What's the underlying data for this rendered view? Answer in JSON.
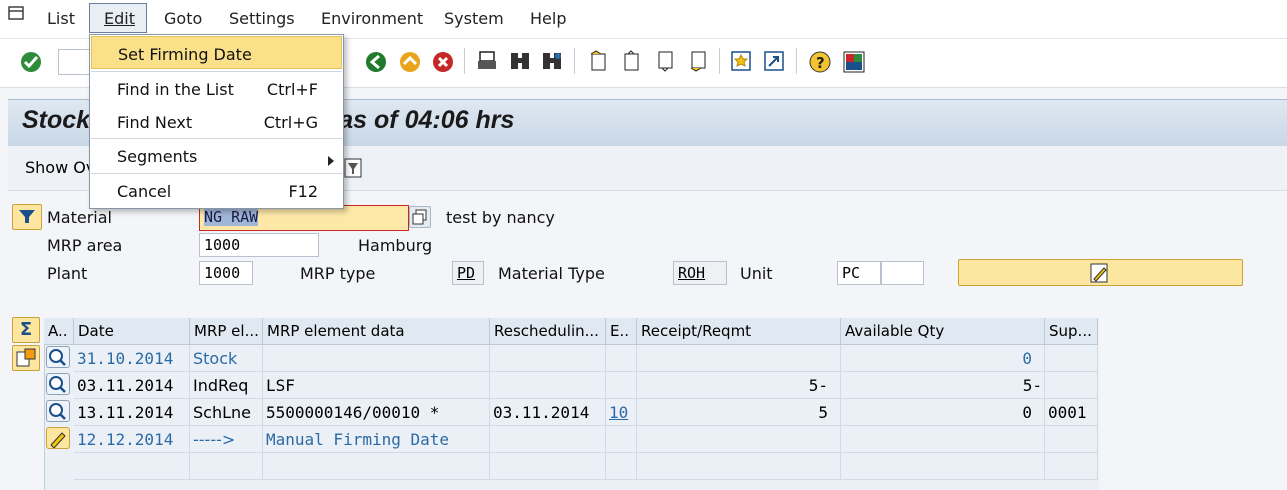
{
  "menubar": {
    "items": [
      "List",
      "Edit",
      "Goto",
      "Settings",
      "Environment",
      "System",
      "Help"
    ]
  },
  "edit_menu": {
    "items": [
      {
        "label": "Set Firming Date",
        "shortcut": ""
      },
      {
        "label": "Find in the List",
        "shortcut": "Ctrl+F"
      },
      {
        "label": "Find Next",
        "shortcut": "Ctrl+G"
      },
      {
        "label": "Segments",
        "shortcut": ""
      },
      {
        "label": "Cancel",
        "shortcut": "F12"
      }
    ]
  },
  "page": {
    "title_left": "Stock",
    "title_right": "t as of 04:06 hrs",
    "show_overview_label": "Show Ov"
  },
  "header": {
    "material_label": "Material",
    "material_value": "NG RAW",
    "material_desc": "test by nancy",
    "mrp_area_label": "MRP area",
    "mrp_area_value": "1000",
    "mrp_area_desc": "Hamburg",
    "plant_label": "Plant",
    "plant_value": "1000",
    "mrp_type_label": "MRP type",
    "mrp_type_value": "PD",
    "material_type_label": "Material Type",
    "material_type_value": "ROH",
    "unit_label": "Unit",
    "unit_value": "PC"
  },
  "table": {
    "columns": [
      "A..",
      "Date",
      "MRP el...",
      "MRP element data",
      "Reschedulin...",
      "E..",
      "Receipt/Reqmt",
      "Available Qty",
      "Sup..."
    ],
    "rows": [
      {
        "date": "31.10.2014",
        "element": "Stock",
        "data": "",
        "resched": "",
        "e": "",
        "receipt": "",
        "available": "0",
        "sup": ""
      },
      {
        "date": "03.11.2014",
        "element": "IndReq",
        "data": "LSF",
        "resched": "",
        "e": "",
        "receipt": "5-",
        "available": "5-",
        "sup": ""
      },
      {
        "date": "13.11.2014",
        "element": "SchLne",
        "data": "5500000146/00010 *",
        "resched": "03.11.2014",
        "e": "10",
        "receipt": "5",
        "available": "0",
        "sup": "0001"
      },
      {
        "date": "12.12.2014",
        "element": "----->",
        "data": "Manual Firming Date",
        "resched": "",
        "e": "",
        "receipt": "",
        "available": "",
        "sup": ""
      }
    ]
  },
  "colors": {
    "highlight": "#fbe08a",
    "link_blue": "#2c6aa6",
    "banner": "#c9d7e6"
  }
}
